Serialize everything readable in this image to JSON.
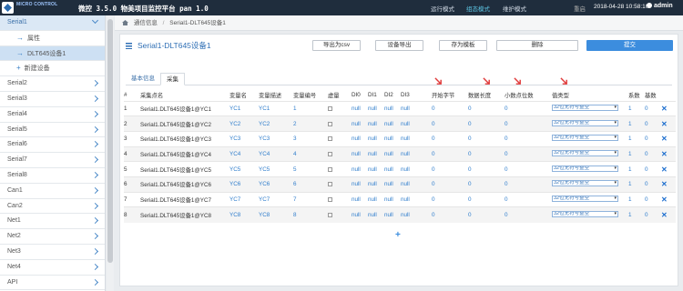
{
  "topbar": {
    "brand_line1": "MICRO CONTROL",
    "app_title": "微控 3.5.0 物美项目监控平台 pan 1.0",
    "modes": [
      "运行模式",
      "组态模式",
      "维护模式"
    ],
    "restart": "重启",
    "datetime": "2018-04-28 10:58:10",
    "user": "admin"
  },
  "sidebar": {
    "items": [
      {
        "label": "Serial1",
        "open": true
      },
      {
        "label": "属性",
        "sub": true,
        "icon": "arrow-right-icon"
      },
      {
        "label": "DLT645设备1",
        "sub": true,
        "active": true,
        "icon": "arrow-right-icon"
      },
      {
        "label": "新建设备",
        "sub": true,
        "icon": "plus-icon"
      },
      {
        "label": "Serial2"
      },
      {
        "label": "Serial3"
      },
      {
        "label": "Serial4"
      },
      {
        "label": "Serial5"
      },
      {
        "label": "Serial6"
      },
      {
        "label": "Serial7"
      },
      {
        "label": "Serial8"
      },
      {
        "label": "Can1"
      },
      {
        "label": "Can2"
      },
      {
        "label": "Net1"
      },
      {
        "label": "Net2"
      },
      {
        "label": "Net3"
      },
      {
        "label": "Net4"
      },
      {
        "label": "API"
      }
    ]
  },
  "breadcrumb": {
    "root": "通信信息",
    "current": "Serial1-DLT645设备1"
  },
  "page": {
    "title": "Serial1-DLT645设备1",
    "buttons": {
      "export_csv": "导出为csv",
      "export_dev": "设备导出",
      "save_tpl": "存为模板",
      "delete": "删除",
      "submit": "提交"
    },
    "tabs": [
      "基本信息",
      "采集"
    ]
  },
  "table": {
    "headers": [
      "#",
      "采集点名",
      "变量名",
      "变量描述",
      "变量编号",
      "虚量",
      "DI0",
      "DI1",
      "DI2",
      "DI3",
      "开始字节",
      "数据长度",
      "小数点位数",
      "值类型",
      "系数",
      "基数"
    ],
    "rows": [
      {
        "n": "1",
        "name": "Serial1.DLT645设备1@YC1",
        "var": "YC1",
        "desc": "YC1",
        "no": "1",
        "di0": "null",
        "di1": "null",
        "di2": "null",
        "di3": "null",
        "start": "0",
        "len": "0",
        "dec": "0",
        "type": "32位无符号整型",
        "coef": "1",
        "base": "0"
      },
      {
        "n": "2",
        "name": "Serial1.DLT645设备1@YC2",
        "var": "YC2",
        "desc": "YC2",
        "no": "2",
        "di0": "null",
        "di1": "null",
        "di2": "null",
        "di3": "null",
        "start": "0",
        "len": "0",
        "dec": "0",
        "type": "32位无符号整型",
        "coef": "1",
        "base": "0"
      },
      {
        "n": "3",
        "name": "Serial1.DLT645设备1@YC3",
        "var": "YC3",
        "desc": "YC3",
        "no": "3",
        "di0": "null",
        "di1": "null",
        "di2": "null",
        "di3": "null",
        "start": "0",
        "len": "0",
        "dec": "0",
        "type": "32位无符号整型",
        "coef": "1",
        "base": "0"
      },
      {
        "n": "4",
        "name": "Serial1.DLT645设备1@YC4",
        "var": "YC4",
        "desc": "YC4",
        "no": "4",
        "di0": "null",
        "di1": "null",
        "di2": "null",
        "di3": "null",
        "start": "0",
        "len": "0",
        "dec": "0",
        "type": "32位无符号整型",
        "coef": "1",
        "base": "0"
      },
      {
        "n": "5",
        "name": "Serial1.DLT645设备1@YC5",
        "var": "YC5",
        "desc": "YC5",
        "no": "5",
        "di0": "null",
        "di1": "null",
        "di2": "null",
        "di3": "null",
        "start": "0",
        "len": "0",
        "dec": "0",
        "type": "32位无符号整型",
        "coef": "1",
        "base": "0"
      },
      {
        "n": "6",
        "name": "Serial1.DLT645设备1@YC6",
        "var": "YC6",
        "desc": "YC6",
        "no": "6",
        "di0": "null",
        "di1": "null",
        "di2": "null",
        "di3": "null",
        "start": "0",
        "len": "0",
        "dec": "0",
        "type": "32位无符号整型",
        "coef": "1",
        "base": "0"
      },
      {
        "n": "7",
        "name": "Serial1.DLT645设备1@YC7",
        "var": "YC7",
        "desc": "YC7",
        "no": "7",
        "di0": "null",
        "di1": "null",
        "di2": "null",
        "di3": "null",
        "start": "0",
        "len": "0",
        "dec": "0",
        "type": "32位无符号整型",
        "coef": "1",
        "base": "0"
      },
      {
        "n": "8",
        "name": "Serial1.DLT645设备1@YC8",
        "var": "YC8",
        "desc": "YC8",
        "no": "8",
        "di0": "null",
        "di1": "null",
        "di2": "null",
        "di3": "null",
        "start": "0",
        "len": "0",
        "dec": "0",
        "type": "32位无符号整型",
        "coef": "1",
        "base": "0"
      }
    ]
  },
  "colors": {
    "accent": "#3c8dde",
    "topbar": "#1f2d3d",
    "annotation_arrow": "#e03a3a"
  }
}
